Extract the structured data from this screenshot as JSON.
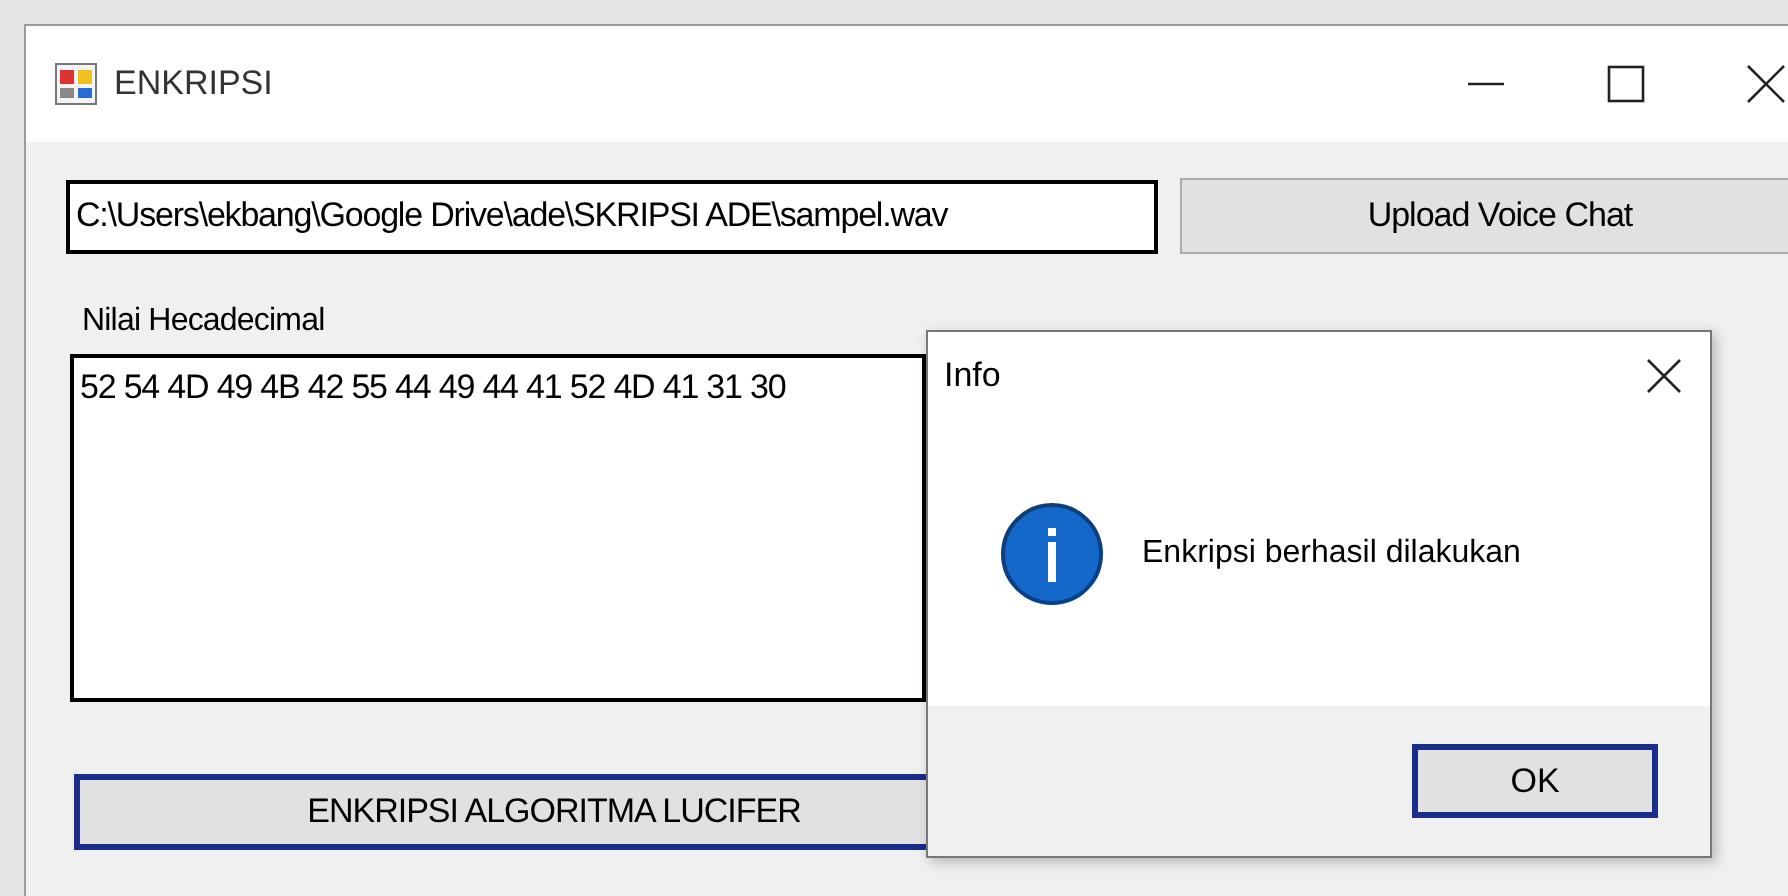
{
  "window": {
    "title": "ENKRIPSI"
  },
  "file_path": {
    "value": "C:\\Users\\ekbang\\Google Drive\\ade\\SKRIPSI ADE\\sampel.wav"
  },
  "upload_button": {
    "label": "Upload Voice Chat"
  },
  "hex_label": "Nilai Hecadecimal",
  "hex_area": {
    "value": "52 54 4D 49 4B 42 55 44 49 44 41 52 4D 41 31 30"
  },
  "encrypt_button": {
    "label": "ENKRIPSI ALGORITMA LUCIFER"
  },
  "dialog": {
    "title": "Info",
    "message": "Enkripsi berhasil dilakukan",
    "button": "OK"
  }
}
